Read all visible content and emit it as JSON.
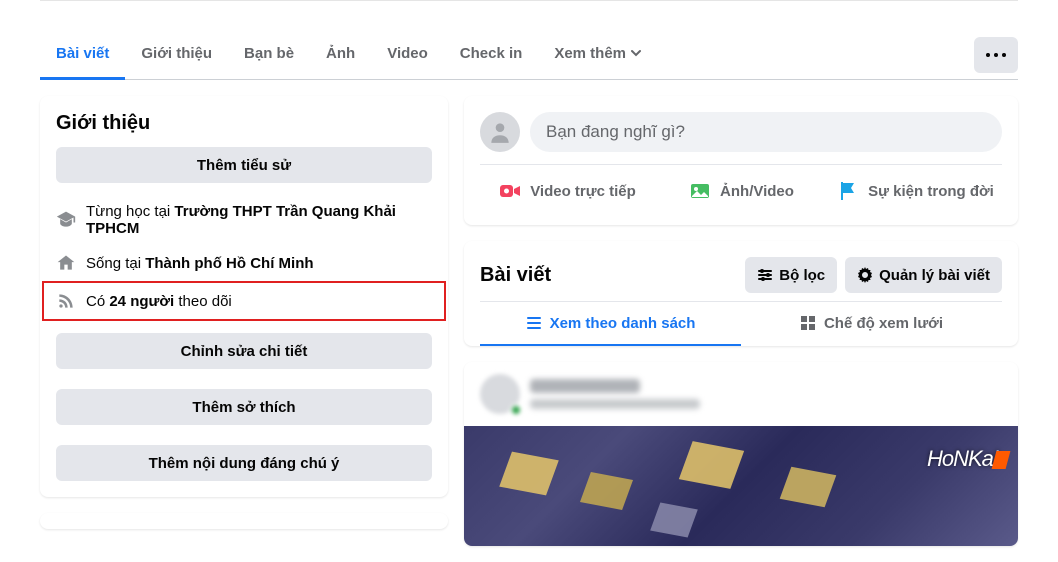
{
  "tabs": {
    "items": [
      {
        "label": "Bài viết"
      },
      {
        "label": "Giới thiệu"
      },
      {
        "label": "Bạn bè"
      },
      {
        "label": "Ảnh"
      },
      {
        "label": "Video"
      },
      {
        "label": "Check in"
      },
      {
        "label": "Xem thêm"
      }
    ]
  },
  "intro": {
    "title": "Giới thiệu",
    "add_bio": "Thêm tiểu sử",
    "school_prefix": "Từng học tại ",
    "school_name": "Trường THPT Trần Quang Khải TPHCM",
    "city_prefix": "Sống tại ",
    "city_name": "Thành phố Hồ Chí Minh",
    "followers_pre": "Có ",
    "followers_count": "24 người",
    "followers_post": " theo dõi",
    "edit_details": "Chỉnh sửa chi tiết",
    "add_hobbies": "Thêm sở thích",
    "add_featured": "Thêm nội dung đáng chú ý"
  },
  "composer": {
    "placeholder": "Bạn đang nghĩ gì?",
    "live": "Video trực tiếp",
    "photo": "Ảnh/Video",
    "life": "Sự kiện trong đời"
  },
  "posts": {
    "title": "Bài viết",
    "filter": "Bộ lọc",
    "manage": "Quản lý bài viết",
    "list_view": "Xem theo danh sách",
    "grid_view": "Chế độ xem lưới",
    "game_logo": "HoNKaI"
  }
}
